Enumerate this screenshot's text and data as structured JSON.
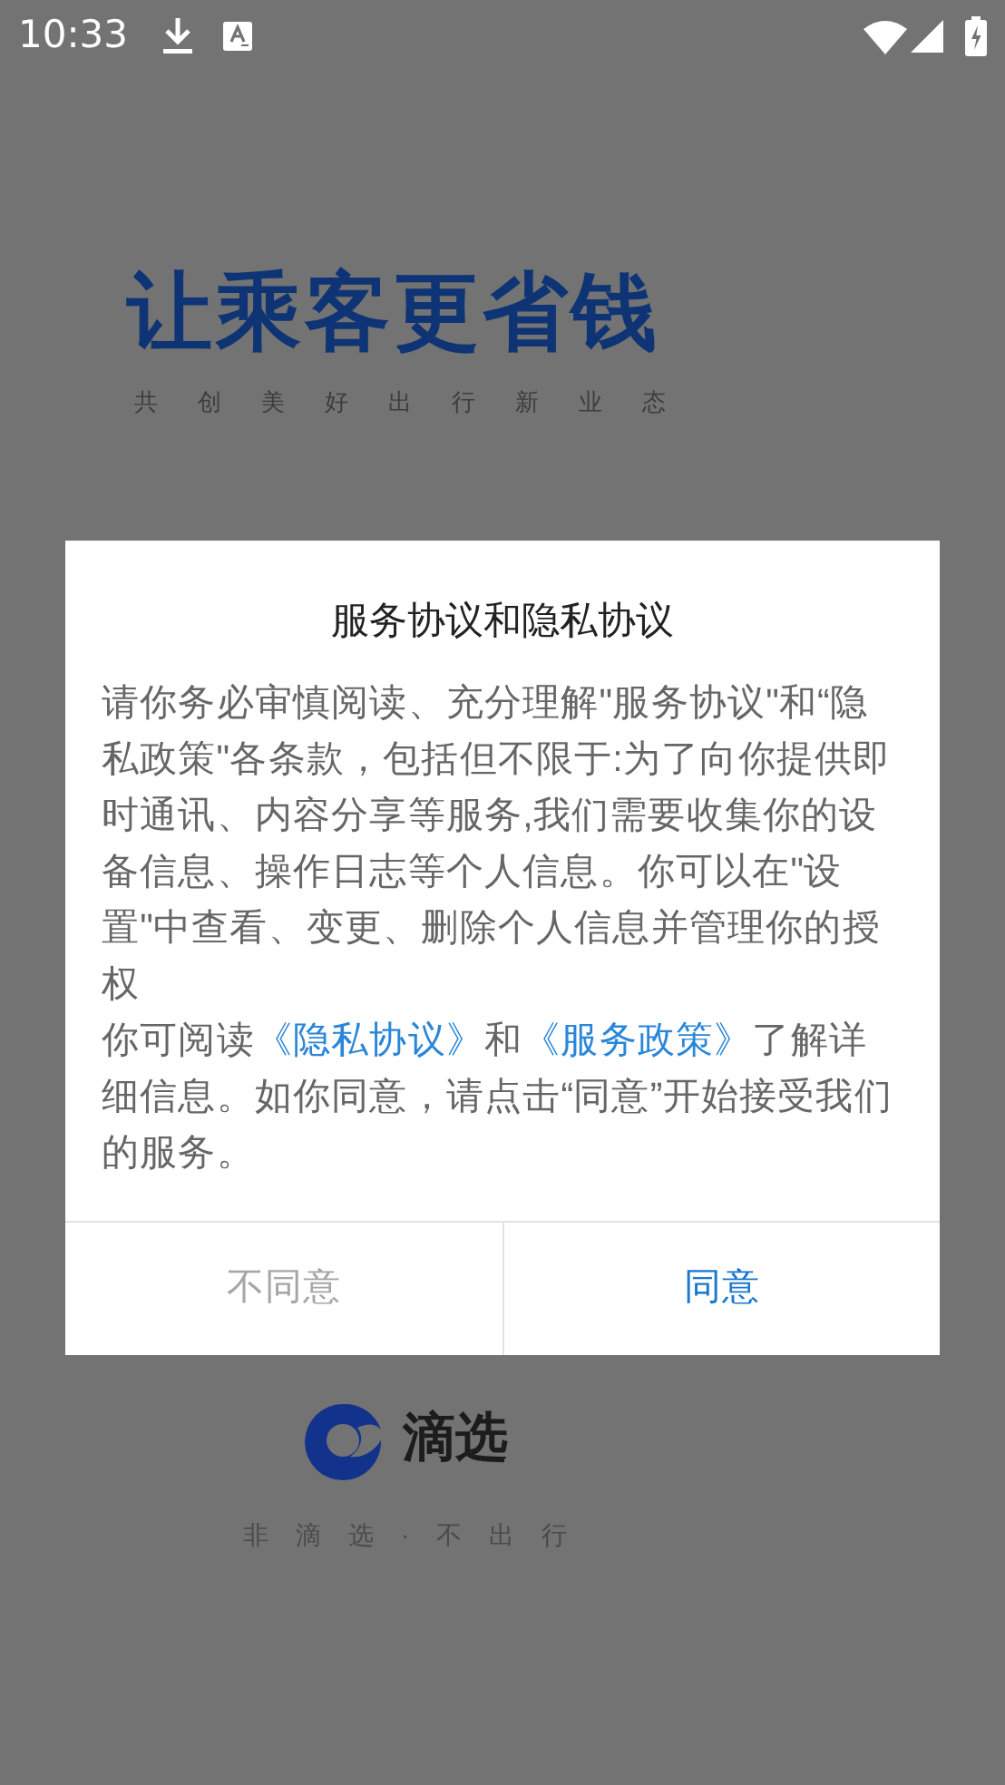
{
  "status_bar": {
    "time": "10:33"
  },
  "splash": {
    "headline": "让乘客更省钱",
    "subtitle": [
      "共",
      "创",
      "美",
      "好",
      "出",
      "行",
      "新",
      "业",
      "态"
    ],
    "brand": "滴选",
    "tagline": [
      "非",
      "滴",
      "选",
      "·",
      "不",
      "出",
      "行"
    ]
  },
  "dialog": {
    "title": "服务协议和隐私协议",
    "paragraphs": [
      [
        {
          "kind": "text",
          "text": "请你务必审慎阅读、充分理解\"服务协议\"和“隐私政策\"各条款，包括但不限于:为了向你提供即时通讯、内容分享等服务,我们需要收集你的设备信息、操作日志等个人信息。你可以在\"设置\"中查看、变更、删除个人信息并管理你的授权"
        }
      ],
      [
        {
          "kind": "text",
          "text": "你可阅读"
        },
        {
          "kind": "link",
          "text": "《隐私协议》"
        },
        {
          "kind": "text",
          "text": "和"
        },
        {
          "kind": "link",
          "text": "《服务政策》"
        },
        {
          "kind": "text",
          "text": "了解详细信息。如你同意，请点击“同意”开始接受我们的服务。"
        }
      ]
    ],
    "buttons": [
      {
        "label": "不同意",
        "kind": "secondary"
      },
      {
        "label": "同意",
        "kind": "primary"
      }
    ]
  }
}
